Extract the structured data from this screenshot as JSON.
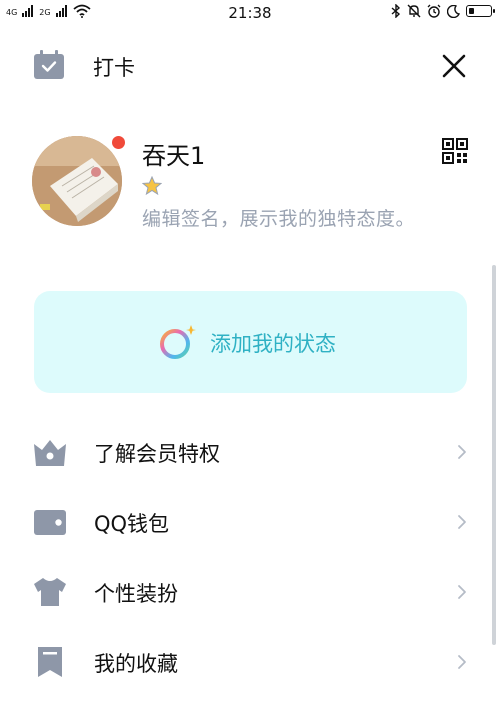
{
  "status_bar": {
    "signal1_label": "4G",
    "signal2_label": "2G",
    "time": "21:38"
  },
  "header": {
    "checkin_label": "打卡"
  },
  "profile": {
    "username": "吞天1",
    "signature": "编辑签名，展示我的独特态度。"
  },
  "status_card": {
    "label": "添加我的状态"
  },
  "menu": {
    "items": [
      {
        "label": "了解会员特权",
        "icon": "crown-icon"
      },
      {
        "label": "QQ钱包",
        "icon": "wallet-icon"
      },
      {
        "label": "个性装扮",
        "icon": "shirt-icon"
      },
      {
        "label": "我的收藏",
        "icon": "bookmark-icon"
      }
    ]
  },
  "colors": {
    "accent_text": "#2fb1c4",
    "card_bg": "#ddfbfc",
    "icon_gray": "#8e97a8",
    "notification_dot": "#f04a3a"
  },
  "battery_level": 0.3
}
